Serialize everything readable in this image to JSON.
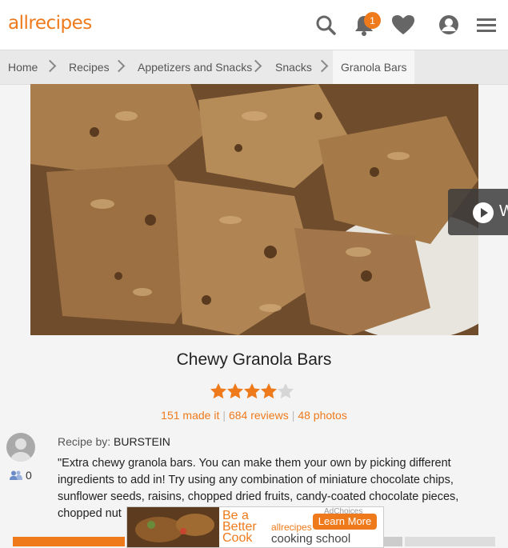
{
  "header": {
    "logo": "allrecipes",
    "notification_count": "1",
    "icons": [
      "search-icon",
      "bell-icon",
      "heart-icon",
      "user-icon",
      "menu-icon"
    ]
  },
  "breadcrumbs": [
    "Home",
    "Recipes",
    "Appetizers and Snacks",
    "Snacks",
    "Granola Bars"
  ],
  "recipe": {
    "title": "Chewy Granola Bars",
    "rating": 4,
    "rating_max": 5,
    "made_it": "151 made it",
    "reviews": "684 reviews",
    "photos": "48 photos",
    "followers": "0",
    "recipe_by_label": "Recipe by:",
    "author": "BURSTEIN",
    "description": "\"Extra chewy granola bars. You can make them your own by picking different ingredients to add in! Try using any combination of miniature chocolate chips, sunflower seeds, raisins, chopped dried fruits, candy-coated chocolate pieces, chopped nut"
  },
  "video_tab_label": "W",
  "ad": {
    "line1": "Be a",
    "line2": "Better",
    "line3": "Cook",
    "brand": "allrecipes",
    "school": "cooking school",
    "button": "Learn More",
    "adchoices": "AdChoices"
  },
  "colors": {
    "accent": "#ef7a1b",
    "star_empty": "#d6d6d6"
  }
}
